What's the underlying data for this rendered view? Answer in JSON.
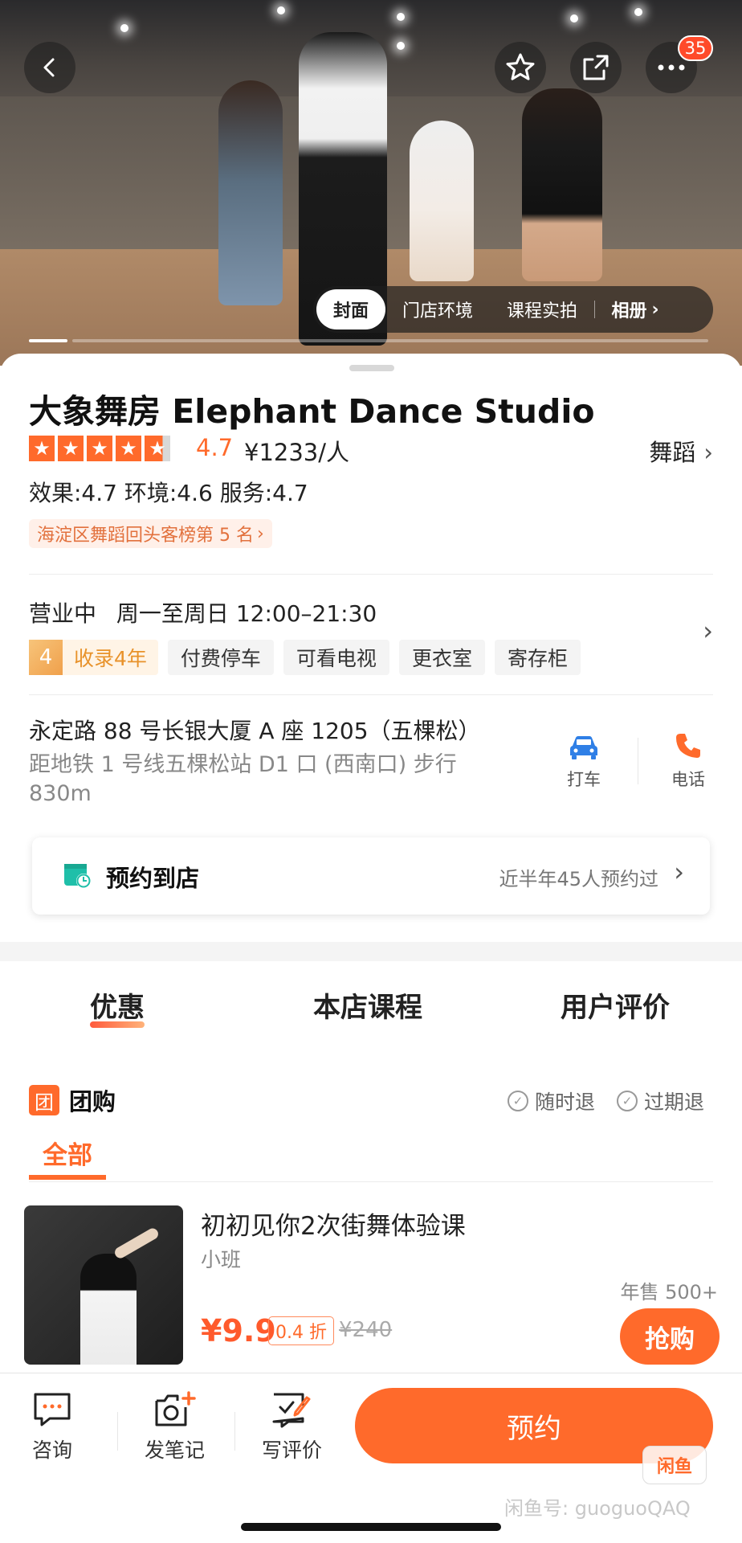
{
  "hero": {
    "notification_count": "35",
    "photo_tabs": [
      "封面",
      "门店环境",
      "课程实拍",
      "相册"
    ],
    "selected_photo_tab": 0
  },
  "shop": {
    "name": "大象舞房 Elephant Dance Studio",
    "rating": "4.7",
    "rating_value": 4.7,
    "price": "¥1233/人",
    "category": "舞蹈",
    "scores": "效果:4.7  环境:4.6  服务:4.7",
    "rank": "海淀区舞蹈回头客榜第 5 名",
    "status": "营业中",
    "hours": "周一至周日 12:00–21:30",
    "years_num": "4",
    "years_label": "收录4年",
    "amenities": [
      "付费停车",
      "可看电视",
      "更衣室",
      "寄存柜"
    ],
    "address": "永定路 88 号长银大厦 A 座 1205（五棵松）",
    "metro": "距地铁 1 号线五棵松站 D1 口 (西南口) 步行 830m",
    "taxi_label": "打车",
    "phone_label": "电话"
  },
  "booking": {
    "label": "预约到店",
    "note": "近半年45人预约过"
  },
  "tabs": [
    "优惠",
    "本店课程",
    "用户评价"
  ],
  "groupbuy": {
    "icon_text": "团",
    "label": "团购",
    "guarantees": [
      "随时退",
      "过期退"
    ],
    "filter": "全部"
  },
  "deal": {
    "title": "初初见你2次街舞体验课",
    "subtitle": "小班",
    "sales": "年售 500+",
    "price": "¥9.9",
    "discount": "0.4 折",
    "original_price": "¥240",
    "buy_label": "抢购"
  },
  "bottom": {
    "consult": "咨询",
    "note": "发笔记",
    "review": "写评价",
    "reserve": "预约",
    "watermark_logo": "闲鱼",
    "watermark_text": "闲鱼号: guoguoQAQ"
  },
  "colors": {
    "accent": "#ff6a2b",
    "years": "#e8922a",
    "booking_icon": "#1fbfa9"
  }
}
